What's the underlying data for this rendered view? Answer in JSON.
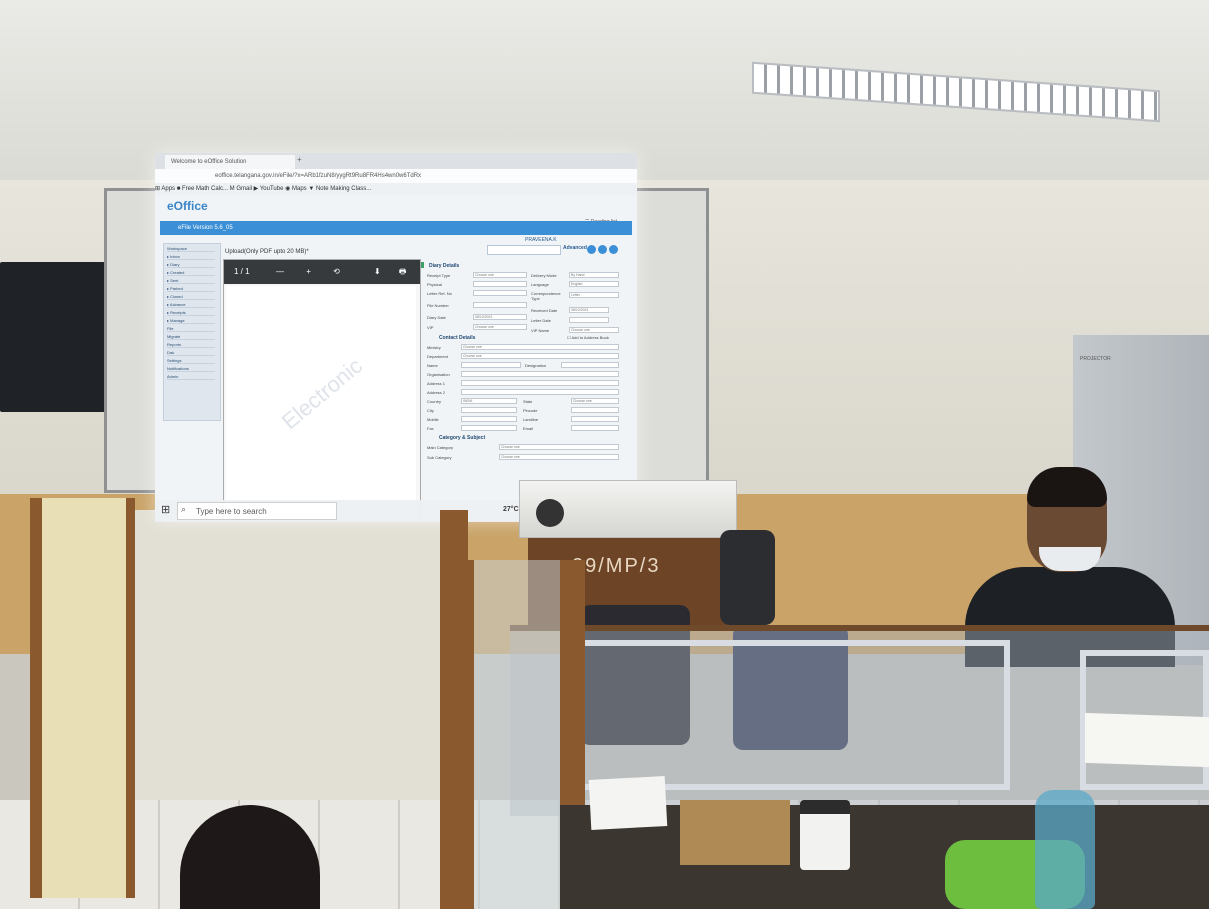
{
  "browser": {
    "tab_title": "Welcome to eOffice Solution",
    "tab_add": "+",
    "address": "eoffice.telangana.gov.in/eFile/?x=ARb1fzuN8/yygRt9Ru8FR4Hs4wn0w6TdRx",
    "bookmarks": "⊞ Apps  ■ Free Math Calc...  M Gmail  ▶ YouTube  ◉ Maps  ▼ Note Making Class...",
    "reading_list": "☰ Reading list"
  },
  "app": {
    "logo": "eOffice",
    "version": "eFile Version 5.6_05",
    "user": "PRAVEENA.K",
    "advanced": "Advanced"
  },
  "sidebar": {
    "items": [
      "Workspace",
      "▸ Inbox",
      "▸ Diary",
      "▸ Created",
      "▸ Sent",
      "▸ Parked",
      "▸ Closed",
      "▸ Advance",
      "▸ Receipts",
      "▸ Manage",
      "File",
      "Migrate",
      "Reports",
      "Dak",
      "Settings",
      "Notifications",
      "Admin"
    ]
  },
  "viewer": {
    "title": "Upload(Only PDF upto 20 MB)*",
    "page": "1 / 1",
    "tools": "— + ⟲",
    "right_tools": "⬇ 🖶 ⋮",
    "watermark": "Electronic"
  },
  "form": {
    "diary_section": "Diary Details",
    "contact_section": "Contact Details",
    "category_section": "Category & Subject",
    "address_book": "☐ Add to Address Book",
    "fields_left": [
      "Receipt Type",
      "Physical",
      "Letter Ref. No",
      "File Number",
      "Diary Date",
      "VIP"
    ],
    "fields_right": [
      "Delivery Mode",
      "Language",
      "Correspondence Type",
      "Received Date",
      "Letter Date",
      "VIP Name"
    ],
    "values_left": [
      "Choose one",
      "",
      "",
      "",
      "08/10/2021",
      "Choose one"
    ],
    "values_right": [
      "By Hand",
      "English",
      "Letter",
      "08/10/2021",
      "",
      "Choose one"
    ],
    "contact_fields": [
      "Ministry",
      "Department",
      "Name",
      "Organisation",
      "Address 1",
      "Address 2",
      "Country",
      "City",
      "Mobile",
      "Fax"
    ],
    "contact_values": [
      "Choose one",
      "Choose one",
      "",
      "",
      "",
      "",
      "INDIA",
      "",
      "",
      ""
    ],
    "contact_right": [
      "Designation",
      "State",
      "Pincode",
      "Landline",
      "Email"
    ],
    "category_fields": [
      "Main Category",
      "Sub Category"
    ],
    "category_values": [
      "Choose one",
      "Choose one"
    ]
  },
  "taskbar": {
    "start": "⊞",
    "search_placeholder": "Type here to search",
    "search_icon": "⌕",
    "temperature": "27°C"
  },
  "room": {
    "stand_text": "29/MP/3",
    "cabinet_label": "PROJECTOR"
  },
  "colors": {
    "accent": "#3b8fd6",
    "wood": "#8a5a2e"
  }
}
